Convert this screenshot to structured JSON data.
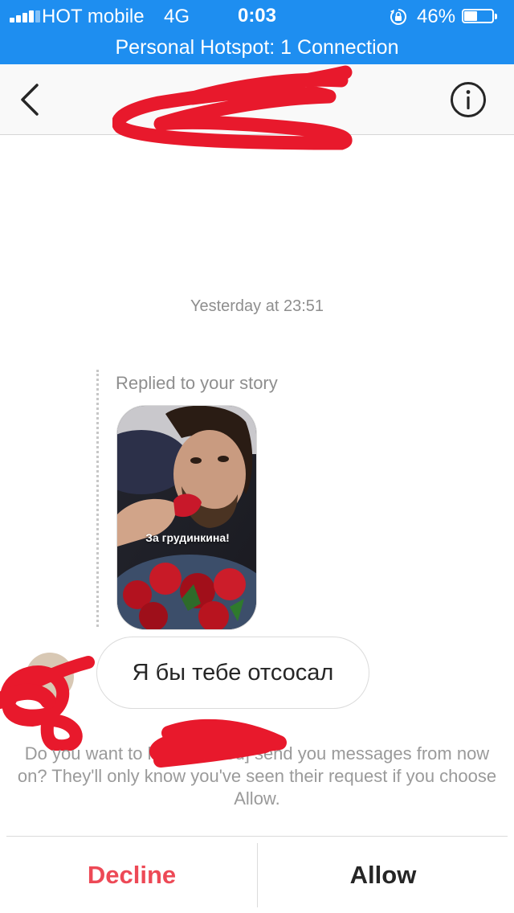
{
  "status_bar": {
    "carrier": "HOT mobile",
    "network": "4G",
    "time": "0:03",
    "battery_percent": "46%",
    "battery_level": 0.46,
    "icons": [
      "signal-icon",
      "lock-rotation-icon",
      "battery-icon"
    ]
  },
  "hotspot_banner": "Personal Hotspot: 1 Connection",
  "header": {
    "title": "",
    "back_icon": "chevron-left-icon",
    "info_icon": "info-icon"
  },
  "conversation": {
    "timestamp": "Yesterday at 23:51",
    "story_reply": {
      "caption": "Replied to your story",
      "sticker_text": "За грудинкина!"
    },
    "message": "Я бы тебе отсосал"
  },
  "request": {
    "text": "Do you want to let [redacted] send you messages from now on? They'll only know you've seen their request if you choose Allow."
  },
  "actions": {
    "decline": "Decline",
    "allow": "Allow"
  },
  "colors": {
    "status_bar": "#1e8ef0",
    "decline": "#ed4956",
    "scribble": "#e8192c"
  }
}
